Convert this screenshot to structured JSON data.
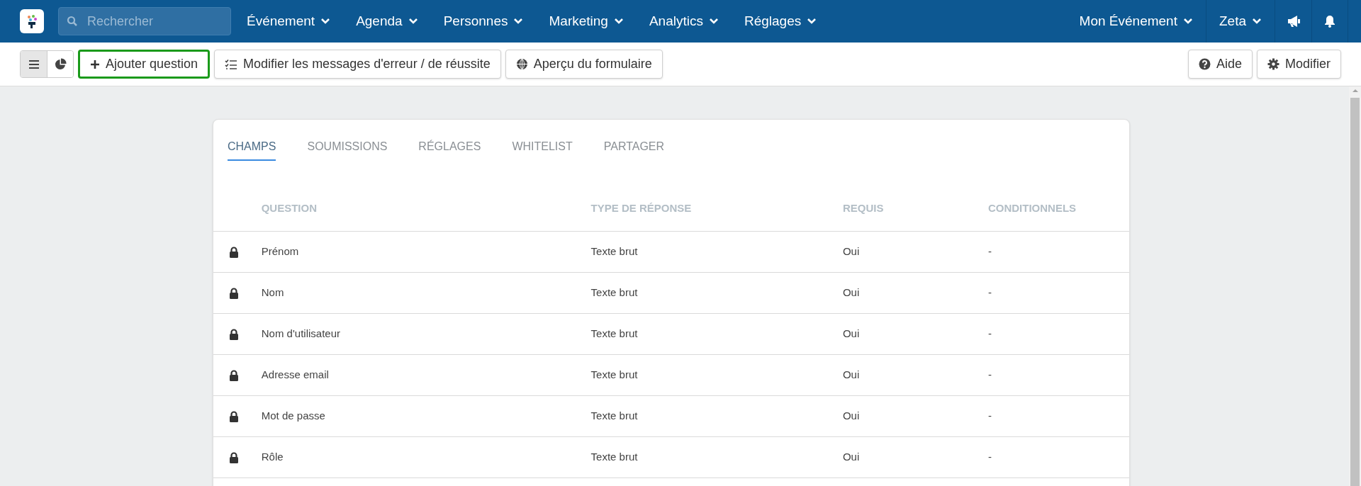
{
  "nav": {
    "search": {
      "placeholder": "Rechercher"
    },
    "menus": [
      "Événement",
      "Agenda",
      "Personnes",
      "Marketing",
      "Analytics",
      "Réglages"
    ],
    "right_menus": [
      "Mon Événement",
      "Zeta"
    ]
  },
  "toolbar": {
    "views": [
      {
        "selected": true
      },
      {
        "selected": false
      }
    ],
    "buttons": [
      {
        "label": "Ajouter question",
        "highlighted": true
      },
      {
        "label": "Modifier les messages d'erreur / de réussite",
        "highlighted": false
      },
      {
        "label": "Aperçu du formulaire",
        "highlighted": false
      }
    ],
    "right_buttons": [
      {
        "label": "Aide"
      },
      {
        "label": "Modifier"
      }
    ]
  },
  "tabs": [
    {
      "label": "CHAMPS",
      "selected": true
    },
    {
      "label": "SOUMISSIONS",
      "selected": false
    },
    {
      "label": "RÉGLAGES",
      "selected": false
    },
    {
      "label": "WHITELIST",
      "selected": false
    },
    {
      "label": "PARTAGER",
      "selected": false
    }
  ],
  "table": {
    "columns": [
      "QUESTION",
      "TYPE DE RÉPONSE",
      "REQUIS",
      "CONDITIONNELS"
    ],
    "rows": [
      {
        "locked": true,
        "cells": [
          "Prénom",
          "Texte brut",
          "Oui",
          "-"
        ]
      },
      {
        "locked": true,
        "cells": [
          "Nom",
          "Texte brut",
          "Oui",
          "-"
        ]
      },
      {
        "locked": true,
        "cells": [
          "Nom d'utilisateur",
          "Texte brut",
          "Oui",
          "-"
        ]
      },
      {
        "locked": true,
        "cells": [
          "Adresse email",
          "Texte brut",
          "Oui",
          "-"
        ]
      },
      {
        "locked": true,
        "cells": [
          "Mot de passe",
          "Texte brut",
          "Oui",
          "-"
        ]
      },
      {
        "locked": true,
        "cells": [
          "Rôle",
          "Texte brut",
          "Oui",
          "-"
        ]
      }
    ]
  }
}
